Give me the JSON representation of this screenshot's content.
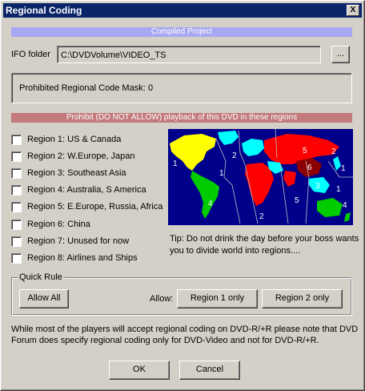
{
  "window": {
    "title": "Regional Coding",
    "close_glyph": "X"
  },
  "compiled_header": "Compiled Project",
  "ifo": {
    "label": "IFO folder",
    "value": "C:\\DVDVolume\\VIDEO_TS",
    "browse_label": "..."
  },
  "mask": {
    "label": "Prohibited Regional Code Mask:",
    "value": "0"
  },
  "prohibit_header": "Prohibit (DO NOT ALLOW) playback of this DVD in these regions",
  "regions": [
    {
      "label": "Region 1: US & Canada",
      "checked": false
    },
    {
      "label": "Region 2: W.Europe, Japan",
      "checked": false
    },
    {
      "label": "Region 3: Southeast Asia",
      "checked": false
    },
    {
      "label": "Region 4: Australia, S America",
      "checked": false
    },
    {
      "label": "Region 5: E.Europe, Russia, Africa",
      "checked": false
    },
    {
      "label": "Region 6: China",
      "checked": false
    },
    {
      "label": "Region 7: Unused for now",
      "checked": false
    },
    {
      "label": "Region 8: Airlines and Ships",
      "checked": false
    }
  ],
  "map": {
    "ocean_color": "#00008b",
    "numbers": [
      "1",
      "2",
      "1",
      "5",
      "6",
      "2",
      "1",
      "3",
      "1",
      "4",
      "5",
      "2",
      "4"
    ]
  },
  "tip": {
    "line1": "Tip: Do not drink the day before your boss wants",
    "line2": "you to divide world into regions...."
  },
  "quick_rule": {
    "group_label": "Quick Rule",
    "allow_all": "Allow All",
    "allow_label": "Allow:",
    "region1_only": "Region 1 only",
    "region2_only": "Region 2 only"
  },
  "note": {
    "line1": "While most of the players will accept regional coding on DVD-R/+R please note that DVD",
    "line2": "Forum does specify regional coding only for DVD-Video and not for DVD-R/+R."
  },
  "buttons": {
    "ok": "OK",
    "cancel": "Cancel"
  }
}
